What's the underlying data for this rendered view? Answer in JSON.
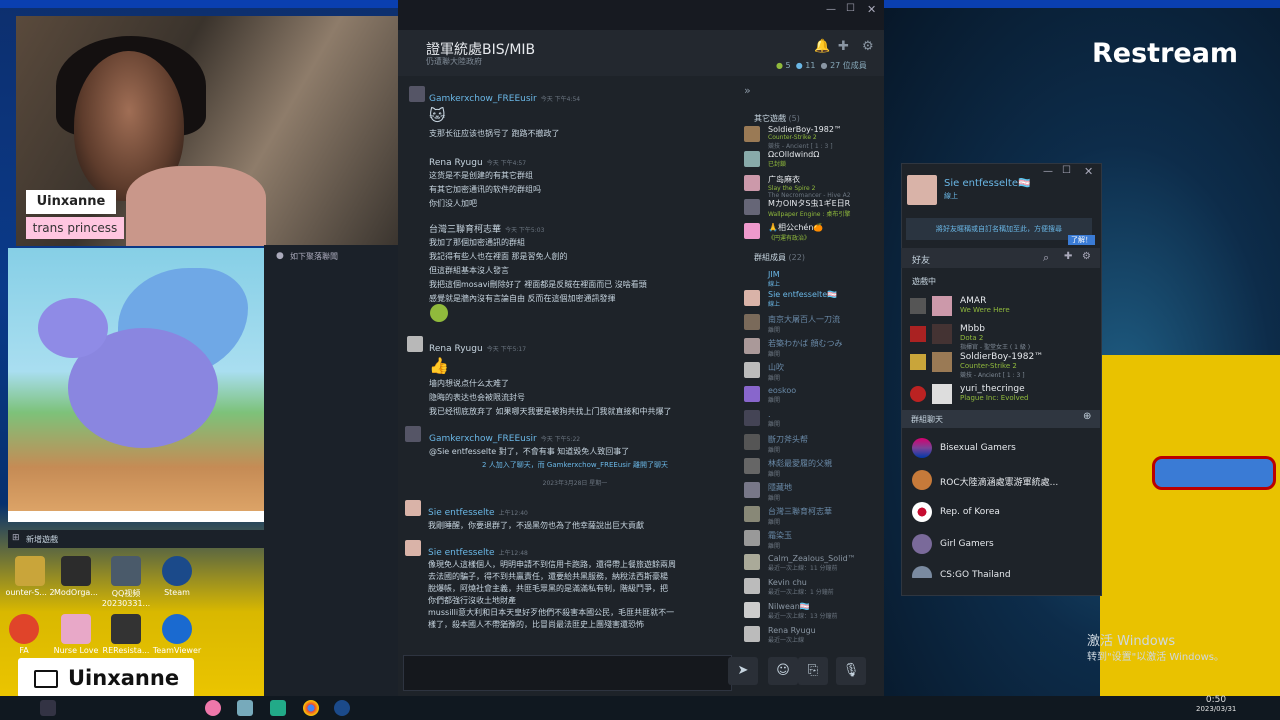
{
  "stream": {
    "brand": "Restream",
    "streamer_name": "Uinxanne",
    "streamer_tag": "trans princess",
    "bottom_name": "Uinxanne"
  },
  "windows_watermark": {
    "line1": "激活 Windows",
    "line2": "转到\"设置\"以激活 Windows。"
  },
  "taskbar": {
    "time": "0:50",
    "date": "2023/03/31"
  },
  "desktop_icons": [
    {
      "label": "ounter-S... 2"
    },
    {
      "label": "ModOrga..."
    },
    {
      "label": "QQ视频 20230331..."
    },
    {
      "label": "Steam"
    },
    {
      "label": "FA"
    },
    {
      "label": "Nurse Love"
    },
    {
      "label": "REResista..."
    },
    {
      "label": "TeamViewer"
    }
  ],
  "left_strip": {
    "notification": "如下聚落聯聞",
    "new_game": "新增遊戲"
  },
  "chat": {
    "title": "證軍統處BIS/MIB",
    "subtitle": "仍遭聯大陸政府",
    "stats": {
      "online": "5",
      "ingame": "11",
      "members": "27 位成員"
    },
    "messages": [
      {
        "author": "Gamkerxchow_FREEusir",
        "time": "今天 下午4:54",
        "lines": [
          "🐱",
          "支那长征应该也锅号了 跑路不撤政了"
        ]
      },
      {
        "author": "Rena Ryugu",
        "time": "今天 下午4:57",
        "lines": [
          "这货是不是创建的有其它群组",
          "有其它加密通讯的软件的群组吗",
          "你们没人加吧"
        ]
      },
      {
        "author": "台灣三聯育柯志華",
        "time": "今天 下午5:03",
        "lines": [
          "我加了那個加密通訊的群組",
          "我記得有些人也在裡面 那是習免人創的",
          "但這群組基本沒人發言",
          "我把這個mosavi刪除好了 裡面都是反賊在裡面而已 沒啥看頭",
          "感覺就是牆內沒有言論自由 反而在這個加密通訊發揮"
        ]
      },
      {
        "author": "Rena Ryugu",
        "time": "今天 下午5:17",
        "lines": [
          "👍",
          "墙内想说点什么太难了",
          "隐晦的表达也会被限流封号",
          "我已经彻底放弃了 如果哪天我要是被狗共找上门我就直接和中共爆了"
        ]
      },
      {
        "author": "Gamkerxchow_FREEusir",
        "time": "今天 下午5:22",
        "lines": [
          "@Sie entfesselte 對了，不會有事 知道毀免人致回事了"
        ]
      }
    ],
    "system_message": "2 人加入了聊天，而 Gamkerxchow_FREEusir 離開了聊天",
    "date_divider": "2023年3月28日 星期一",
    "messages2": [
      {
        "author": "Sie entfesselte",
        "time": "上午12:40",
        "lines": [
          "我剛睡醒，你要退群了，不過黑勿也為了他幸薩說出巨大貢獻"
        ]
      },
      {
        "author": "Sie entfesselte",
        "time": "上午12:48",
        "lines": [
          "像現免人這樣個人，明明申請不到信用卡跑路，還得帶上餐旅遊餘兩周",
          "去法國的騙子，得不到共贏責任，還要給共黑服務，納稅法西斯豪楊",
          "脫爆帳，阿燒社會主義，共匪毛眾黑的是滿滿私有制，階級鬥爭，把",
          "你們都強行沒收土地財產",
          "mussilli意大利和日本天皇好歹他們不殺害本國公民，毛匪共匪就不一",
          "樣了，殺本國人不帶猶豫的，比冒尚最法匪史上團殘害還恐怖"
        ]
      }
    ],
    "input_placeholder": ""
  },
  "members": {
    "other_games_title": "其它遊戲",
    "other_games_count": "(5)",
    "other_games": [
      {
        "name": "SoldierBoy-1982™",
        "status": "Counter-Strike 2",
        "detail": "競技 - Ancient [ 1 : 3 ]"
      },
      {
        "name": "ΩcOlldwindΩ",
        "status": "已封鎖",
        "detail": ""
      },
      {
        "name": "广岛麻衣",
        "status": "Slay the Spire 2",
        "detail": "The Necromancer - Hive A2"
      },
      {
        "name": "MカOlNタS虫1ギE日R",
        "status": "Wallpaper Engine : 桌布引擎",
        "detail": ""
      },
      {
        "name": "🙏相公chén🍊",
        "status": "《円運有政治》",
        "detail": ""
      }
    ],
    "group_members_title": "群組成員",
    "group_members_count": "(22)",
    "group_members": [
      {
        "name": "JIM",
        "status": "線上"
      },
      {
        "name": "Sie entfesselte🏳️‍⚧️",
        "status": "線上"
      },
      {
        "name": "南京大屠百人一刀流",
        "status": "離開"
      },
      {
        "name": "若築わかば 顔むつみ",
        "status": "離開"
      },
      {
        "name": "山吹",
        "status": "離開"
      },
      {
        "name": "eoskoo",
        "status": "離開"
      },
      {
        "name": ".",
        "status": "離開"
      },
      {
        "name": "斷刀斧头帮",
        "status": "離開"
      },
      {
        "name": "林彪最愛履的父親",
        "status": "離開"
      },
      {
        "name": "隱藏地",
        "status": "離開"
      },
      {
        "name": "台灣三聯育柯志華",
        "status": "離開"
      },
      {
        "name": "霜染玉",
        "status": "離開"
      },
      {
        "name": "Calm_Zealous_Solid™",
        "status": "最近一次上線：11 分鐘前"
      },
      {
        "name": "Kevin chu",
        "status": "最近一次上線：1 分鐘前"
      },
      {
        "name": "Nilwean🏳️‍⚧️",
        "status": "最近一次上線：13 分鐘前"
      },
      {
        "name": "Rena Ryugu",
        "status": "最近一次上線"
      }
    ]
  },
  "friends": {
    "user": "Sie entfesselte🏳️‍⚧️",
    "user_status": "線上",
    "notice": "將好友暱稱或自訂名稱加至此，方便搜尋",
    "notice_button": "了解！",
    "search_label": "好友",
    "in_game_title": "遊戲中",
    "in_game": [
      {
        "name": "AMAR",
        "game": "We Were Here",
        "detail": ""
      },
      {
        "name": "Mbbb",
        "game": "Dota 2",
        "detail": "指揮官 - 聖堂女王 ( 1 級 )"
      },
      {
        "name": "SoldierBoy-1982™",
        "game": "Counter-Strike 2",
        "detail": "競技 - Ancient [ 1 : 3 ]"
      },
      {
        "name": "yuri_thecringe",
        "game": "Plague Inc: Evolved",
        "detail": ""
      }
    ],
    "group_chat_title": "群組聊天",
    "groups": [
      {
        "name": "Bisexual Gamers"
      },
      {
        "name": "ROC大陸滴涵處憲游軍統處..."
      },
      {
        "name": "Rep. of Korea"
      },
      {
        "name": "Girl Gamers"
      },
      {
        "name": "CS:GO Thailand"
      }
    ]
  },
  "colors": {
    "steam_bg": "#1e2329",
    "steam_link": "#6ab7e6",
    "steam_ingame": "#90ba3c",
    "ukraine_yellow": "#e9c200",
    "ukraine_blue": "#0a3fb0"
  }
}
